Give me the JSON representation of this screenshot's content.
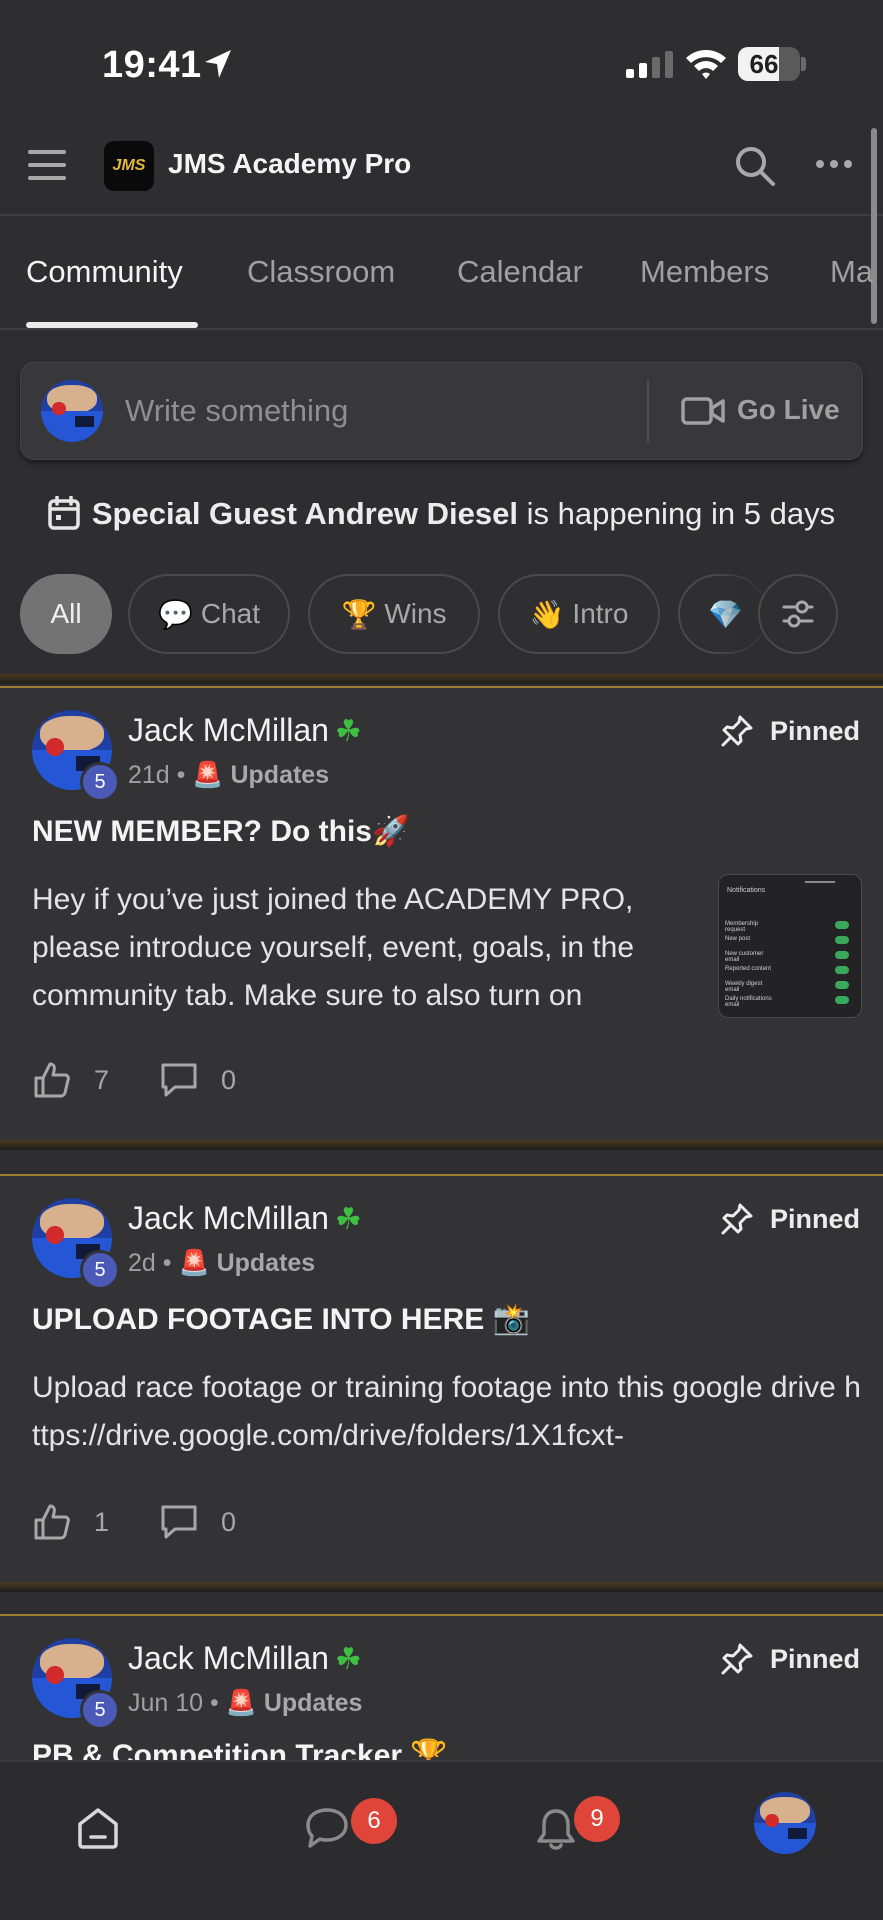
{
  "status_bar": {
    "time": "19:41",
    "battery": "66",
    "battery_level": 0.66
  },
  "header": {
    "logo_text": "JMS",
    "title": "JMS Academy Pro"
  },
  "tabs": [
    "Community",
    "Classroom",
    "Calendar",
    "Members",
    "Ma"
  ],
  "composer": {
    "placeholder": "Write something",
    "go_live": "Go Live"
  },
  "event_banner": {
    "name": "Special Guest Andrew Diesel",
    "suffix": " is happening in 5 days"
  },
  "filters": [
    {
      "label": "All",
      "emoji": ""
    },
    {
      "label": "Chat",
      "emoji": "💬"
    },
    {
      "label": "Wins",
      "emoji": "🏆"
    },
    {
      "label": "Intro",
      "emoji": "👋"
    },
    {
      "label": "",
      "emoji": "💎"
    }
  ],
  "posts": [
    {
      "author": "Jack McMillan",
      "level": "5",
      "time": "21d",
      "category": "Updates",
      "pinned": "Pinned",
      "title": "NEW MEMBER? Do this🚀",
      "body": "Hey if you’ve just joined the ACADEMY PRO, please introduce yourself, event, goals, in the community tab. Make sure to also turn on",
      "likes": "7",
      "comments": "0",
      "thumbnail": {
        "heading": "Notifications",
        "rows": [
          "Membership request",
          "New post",
          "New customer email",
          "Reported content",
          "Weekly digest email",
          "Daily notifications email"
        ]
      }
    },
    {
      "author": "Jack McMillan",
      "level": "5",
      "time": "2d",
      "category": "Updates",
      "pinned": "Pinned",
      "title": "UPLOAD FOOTAGE INTO HERE 📸",
      "body": "Upload race footage or training footage into this google drive https://drive.google.com/drive/folders/1X1fcxt-",
      "likes": "1",
      "comments": "0"
    },
    {
      "author": "Jack McMillan",
      "level": "5",
      "time": "Jun 10",
      "category": "Updates",
      "pinned": "Pinned",
      "title": "PB & Competition Tracker 🏆"
    }
  ],
  "bottom_nav": {
    "chat_badge": "6",
    "notifications_badge": "9"
  },
  "colors": {
    "background": "#2e2e30",
    "card": "#333335",
    "accent_gold": "#9e7c32",
    "badge_red": "#e0453a",
    "level_blue": "#4b59b8"
  }
}
